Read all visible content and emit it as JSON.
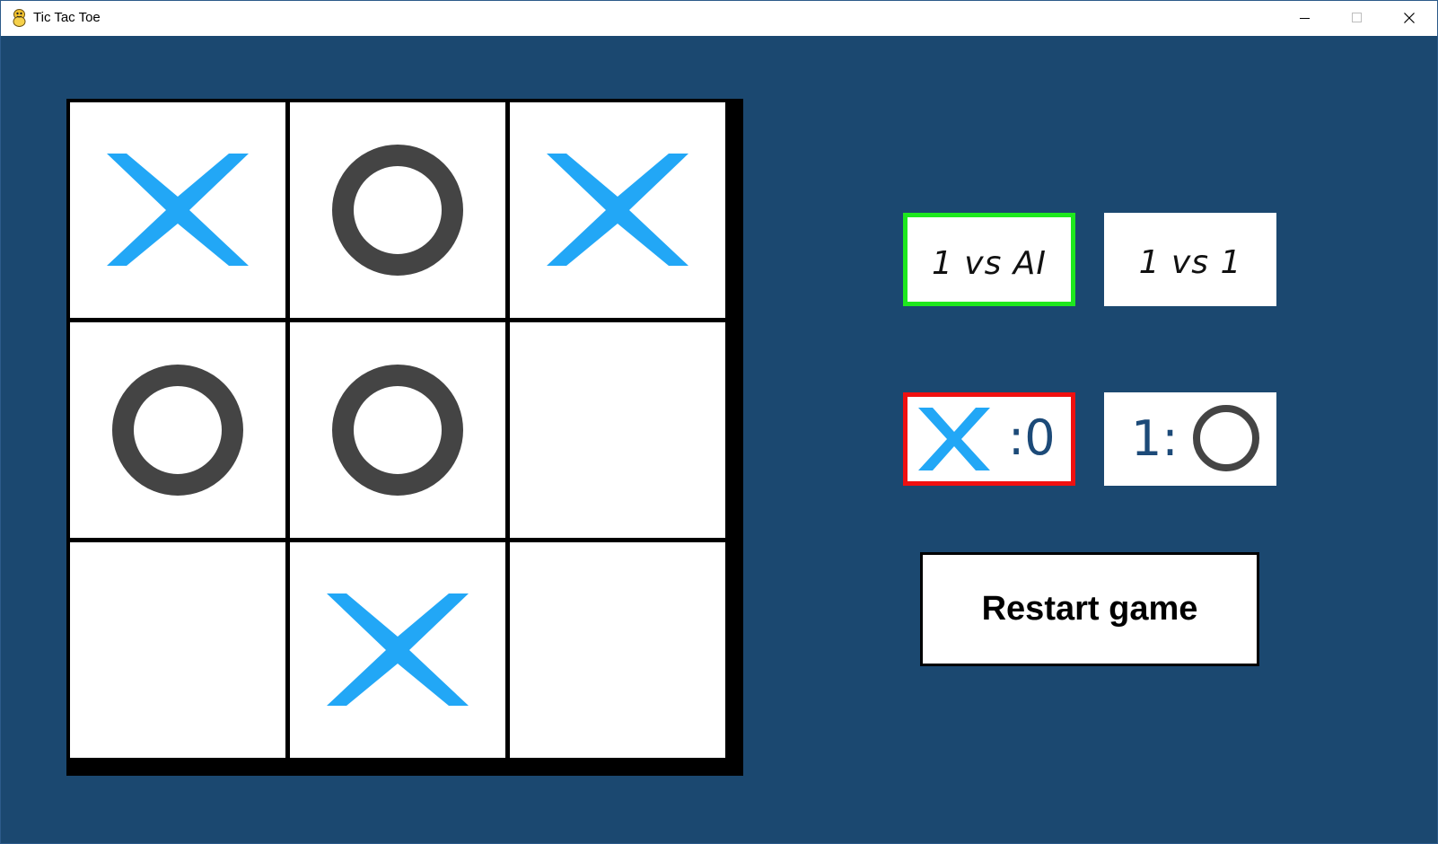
{
  "window": {
    "title": "Tic Tac Toe",
    "icon": "python-snake-icon"
  },
  "colors": {
    "background": "#1b4870",
    "x_mark": "#22a7f6",
    "o_mark": "#444444",
    "selected_mode_border": "#1ee81e",
    "active_player_border": "#f01010",
    "score_text": "#1c4a78"
  },
  "board": {
    "cells": [
      "X",
      "O",
      "X",
      "O",
      "O",
      "",
      "",
      "X",
      ""
    ]
  },
  "modes": {
    "vs_ai_label": "1 vs AI",
    "vs_player_label": "1 vs 1",
    "selected": "1 vs AI"
  },
  "score": {
    "x_text": ":0",
    "o_text": "1:",
    "active_player": "X"
  },
  "controls": {
    "restart_label": "Restart game"
  }
}
